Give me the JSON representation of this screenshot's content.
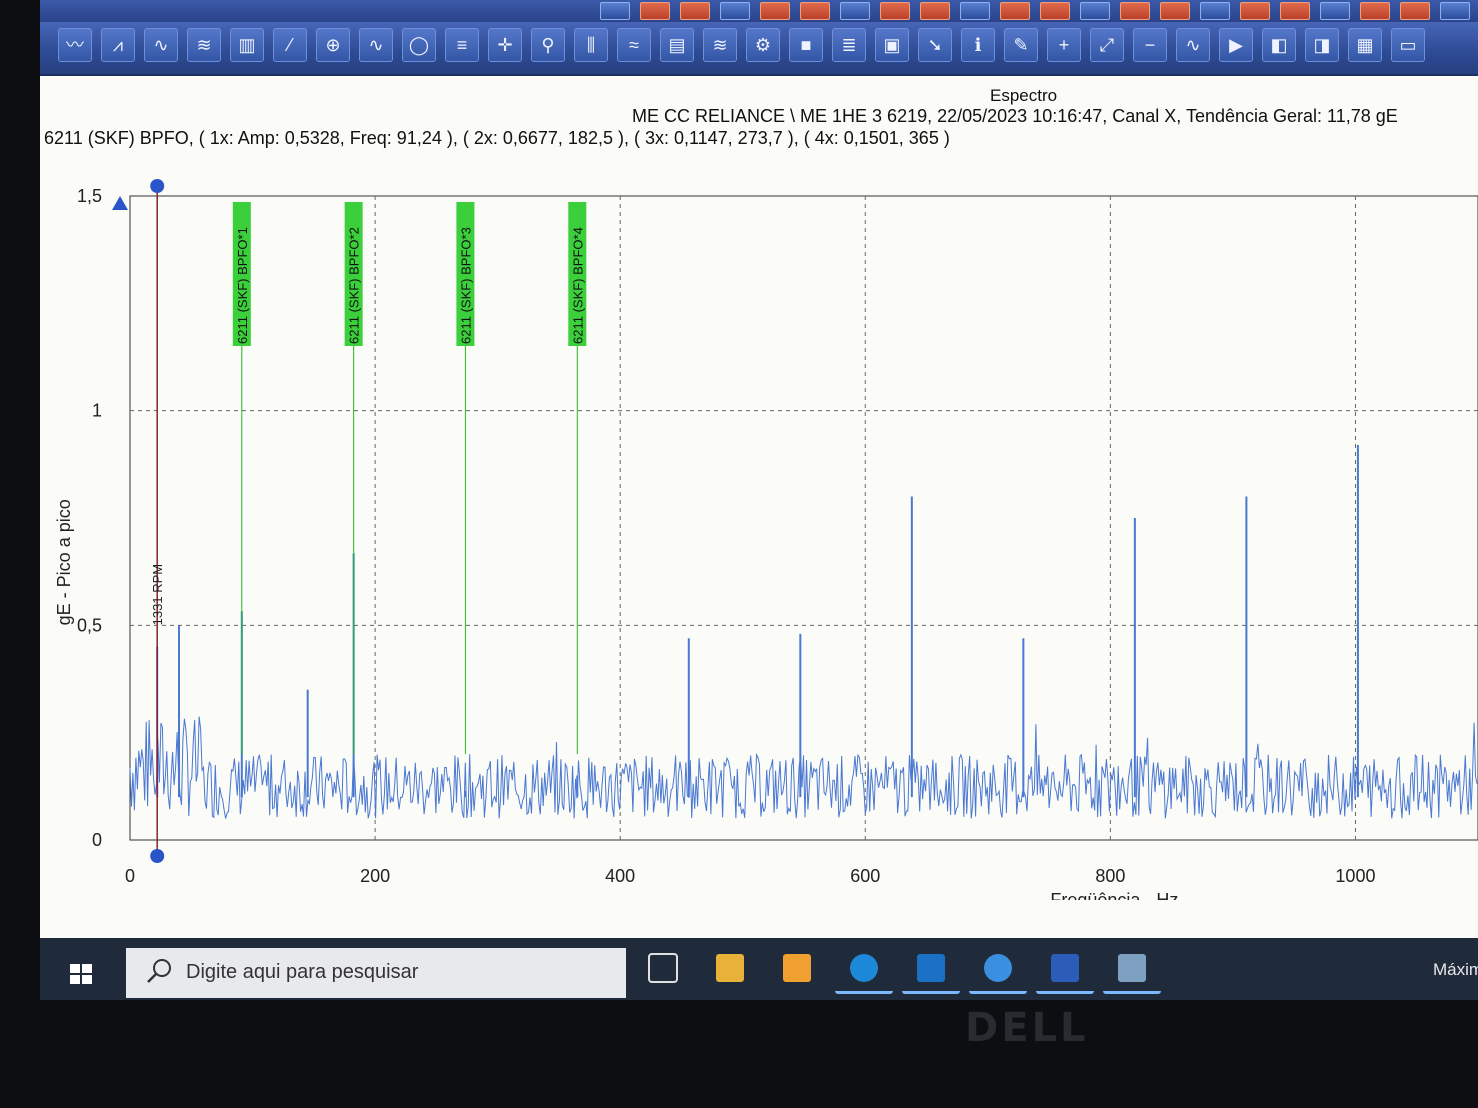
{
  "window": {
    "plot_title": "Espectro",
    "header_line": "ME CC RELIANCE \\ ME   1HE 3 6219, 22/05/2023 10:16:47, Canal X, Tendência Geral: 11,78 gE",
    "bpfo_line": "6211 (SKF) BPFO, ( 1x: Amp: 0,5328, Freq: 91,24 ), ( 2x: 0,6677, 182,5 ), ( 3x: 0,1147, 273,7 ), ( 4x: 0,1501, 365 )"
  },
  "toolbar": {
    "icons": [
      "waveform-icon",
      "spectrum-icon",
      "sine-icon",
      "waterfall-icon",
      "bar-spectrum-icon",
      "trend-icon",
      "orbit-icon",
      "envelope-icon",
      "circle-icon",
      "filter-icon",
      "cursor-icon",
      "zoom-icon",
      "harmonic-icon",
      "sideband-icon",
      "marker-icon",
      "overlay-icon",
      "settings-icon",
      "black-box-icon",
      "list-icon",
      "book-icon",
      "export-icon",
      "info-icon",
      "edit-icon",
      "add-icon",
      "expand-icon",
      "minus-icon",
      "peak-icon",
      "play-icon",
      "layout-icon",
      "layout-alt-icon",
      "grid-icon",
      "window-icon"
    ]
  },
  "chart_data": {
    "type": "line",
    "xlabel": "Freqüência - Hz",
    "ylabel": "gE - Pico a pico",
    "xlim": [
      0,
      1100
    ],
    "ylim": [
      0,
      1.5
    ],
    "x_ticks": [
      "0",
      "200",
      "400",
      "600",
      "800",
      "1000"
    ],
    "y_ticks": [
      "0",
      "0,5",
      "1",
      "1,5"
    ],
    "grid": true,
    "cursor": {
      "label": "1331 RPM",
      "x": 22.2
    },
    "fault_markers": [
      {
        "label": "6211 (SKF) BPFO*1",
        "x": 91.24
      },
      {
        "label": "6211 (SKF) BPFO*2",
        "x": 182.5
      },
      {
        "label": "6211 (SKF) BPFO*3",
        "x": 273.7
      },
      {
        "label": "6211 (SKF) BPFO*4",
        "x": 365
      }
    ],
    "peaks": [
      {
        "x": 22.2,
        "y": 0.45
      },
      {
        "x": 40,
        "y": 0.5
      },
      {
        "x": 91.24,
        "y": 0.5328
      },
      {
        "x": 145,
        "y": 0.35
      },
      {
        "x": 182.5,
        "y": 0.6677
      },
      {
        "x": 273.7,
        "y": 0.1147
      },
      {
        "x": 365,
        "y": 0.1501
      },
      {
        "x": 456,
        "y": 0.47
      },
      {
        "x": 547,
        "y": 0.48
      },
      {
        "x": 638,
        "y": 0.8
      },
      {
        "x": 729,
        "y": 0.47
      },
      {
        "x": 820,
        "y": 0.75
      },
      {
        "x": 911,
        "y": 0.8
      },
      {
        "x": 1002,
        "y": 0.92
      }
    ],
    "noise_floor": [
      0.05,
      0.2
    ],
    "series_color": "#4a78d2",
    "marker_color": "#22bb22",
    "cursor_color": "#8a2030"
  },
  "taskbar": {
    "search_placeholder": "Digite aqui para pesquisar",
    "apps": [
      "task-view-icon",
      "file-explorer-icon",
      "fluke-app-icon",
      "edge-icon",
      "outlook-icon",
      "internet-explorer-icon",
      "word-icon",
      "analysis-app-icon"
    ],
    "tray_text": "Máxim"
  },
  "bezel": {
    "logo": "DELL"
  }
}
